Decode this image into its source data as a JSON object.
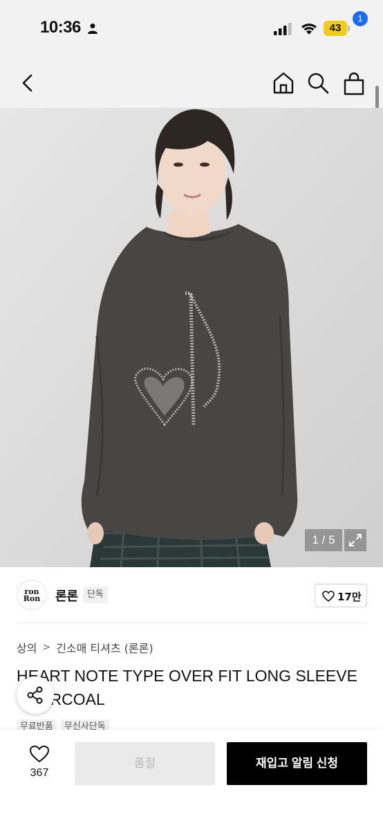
{
  "status_bar": {
    "time": "10:36",
    "battery": "43"
  },
  "nav": {
    "cart_badge": "1"
  },
  "gallery": {
    "counter": "1 / 5"
  },
  "brand": {
    "logo_text_line1": "ron",
    "logo_text_line2": "Ron",
    "name": "론론",
    "tag": "단독",
    "likes": "17만"
  },
  "breadcrumb": {
    "category": "상의",
    "separator": ">",
    "subcategory": "긴소매 티셔츠 (론론)"
  },
  "product": {
    "title_line1": "HEART NOTE TYPE OVER FIT LONG SLEEVE",
    "title_line2": "CHARCOAL",
    "tags": [
      "무료반품",
      "무신사단독"
    ]
  },
  "bottom_bar": {
    "wish_count": "367",
    "soldout_label": "품절",
    "restock_label": "재입고 알림 신청"
  },
  "icons": {
    "person": "person-icon",
    "signal": "signal-icon",
    "wifi": "wifi-icon",
    "back": "chevron-left-icon",
    "home": "home-icon",
    "search": "search-icon",
    "cart": "cart-icon",
    "expand": "expand-icon",
    "heart": "heart-icon",
    "share": "share-icon"
  },
  "colors": {
    "accent_badge": "#1b6cf0",
    "battery": "#f2cc1d",
    "primary_button": "#000000",
    "disabled_button": "#eaeaea"
  }
}
